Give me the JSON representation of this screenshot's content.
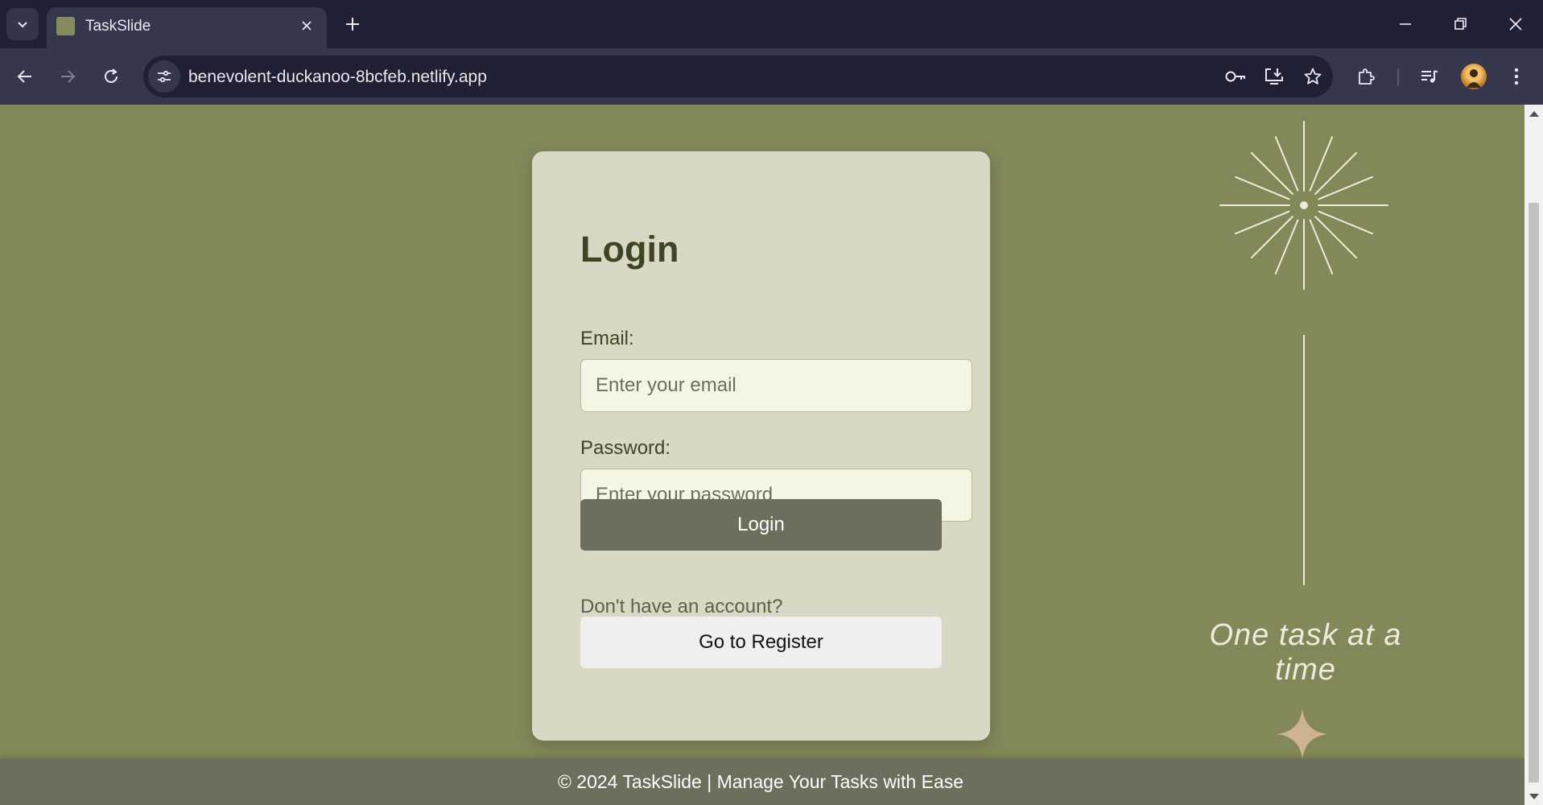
{
  "browser": {
    "tab_title": "TaskSlide",
    "url": "benevolent-duckanoo-8bcfeb.netlify.app"
  },
  "login": {
    "title": "Login",
    "email_label": "Email:",
    "email_placeholder": "Enter your email",
    "email_value": "",
    "password_label": "Password:",
    "password_placeholder": "Enter your password",
    "password_value": "",
    "login_button": "Login",
    "no_account_text": "Don't have an account?",
    "register_button": "Go to Register"
  },
  "decor": {
    "tagline": "One task at a time"
  },
  "footer": {
    "text": "© 2024 TaskSlide | Manage Your Tasks with Ease"
  },
  "colors": {
    "page_background": "#838859",
    "card_background": "#d9d8c4",
    "input_background": "#f5f5e4",
    "primary_button": "#6b6f5c",
    "secondary_button": "#efefef",
    "title_text": "#3f4424",
    "sparkle": "#cdb392",
    "browser_frame": "#1f2033",
    "browser_toolbar": "#35374d"
  },
  "icons": {
    "tab_list": "chevron-down-icon",
    "tab_close": "close-icon",
    "new_tab": "plus-icon",
    "back": "arrow-left-icon",
    "forward": "arrow-right-icon",
    "reload": "reload-icon",
    "site_info": "tune-icon",
    "password_manager": "key-icon",
    "install_app": "install-icon",
    "bookmark": "star-icon",
    "extensions": "puzzle-icon",
    "media": "music-queue-icon",
    "menu": "kebab-menu-icon"
  }
}
